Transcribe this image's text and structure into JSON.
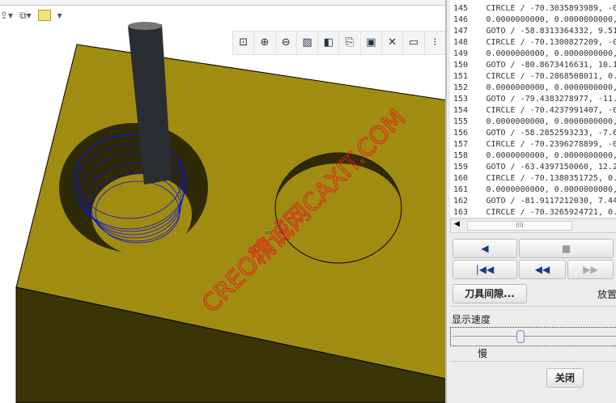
{
  "toolbar": {
    "icons": [
      "regenerate-icon",
      "windows-icon",
      "open-folder-icon",
      "more-icon"
    ]
  },
  "view_toolbar": {
    "icons": [
      "refit-icon",
      "zoom-in-icon",
      "zoom-out-icon",
      "repaint-icon",
      "display-style-icon",
      "named-view-icon",
      "saved-views-icon",
      "datum-display-icon",
      "spin-center-icon",
      "annotation-icon"
    ]
  },
  "watermark": "CREO精诚网CAXIT.COM",
  "nc_list": [
    {
      "n": "145",
      "t": "CIRCLE / -70.3035893989, -0"
    },
    {
      "n": "146",
      "t": "0.0000000000, 0.0000000000,"
    },
    {
      "n": "147",
      "t": "GOTO / -58.8313364332, 9.51"
    },
    {
      "n": "148",
      "t": "CIRCLE / -70.1300827209, -0"
    },
    {
      "n": "149",
      "t": "0.0000000000, 0.0000000000,"
    },
    {
      "n": "150",
      "t": "GOTO / -80.8673416631, 10.1"
    },
    {
      "n": "151",
      "t": "CIRCLE / -70.2868508011, 0."
    },
    {
      "n": "152",
      "t": "0.0000000000, 0.0000000000,"
    },
    {
      "n": "153",
      "t": "GOTO / -79.4383278977, -11."
    },
    {
      "n": "154",
      "t": "CIRCLE / -70.4237991407, -0"
    },
    {
      "n": "155",
      "t": "0.0000000000, 0.0000000000,"
    },
    {
      "n": "156",
      "t": "GOTO / -58.2852593233, -7.6"
    },
    {
      "n": "157",
      "t": "CIRCLE / -70.2396278899, -0"
    },
    {
      "n": "158",
      "t": "0.0000000000, 0.0000000000,"
    },
    {
      "n": "159",
      "t": "GOTO / -63.4397150060, 12.2"
    },
    {
      "n": "160",
      "t": "CIRCLE / -70.1380351725, 0."
    },
    {
      "n": "161",
      "t": "0.0000000000, 0.0000000000,"
    },
    {
      "n": "162",
      "t": "GOTO / -81.9117212030, 7.44"
    },
    {
      "n": "163",
      "t": "CIRCLE / -70.3265924721, 0."
    }
  ],
  "controls": {
    "play_back": "◀",
    "stop": "■",
    "rewind_start": "|◀◀",
    "step_back": "◀◀",
    "step_fwd": "▶▶",
    "tool_clearance": "刀具间隙...",
    "place_label": "放置",
    "speed_label": "显示速度",
    "slow_label": "慢",
    "close": "关闭"
  },
  "speed_value": 0.45,
  "scroll_thumb": "IIII"
}
